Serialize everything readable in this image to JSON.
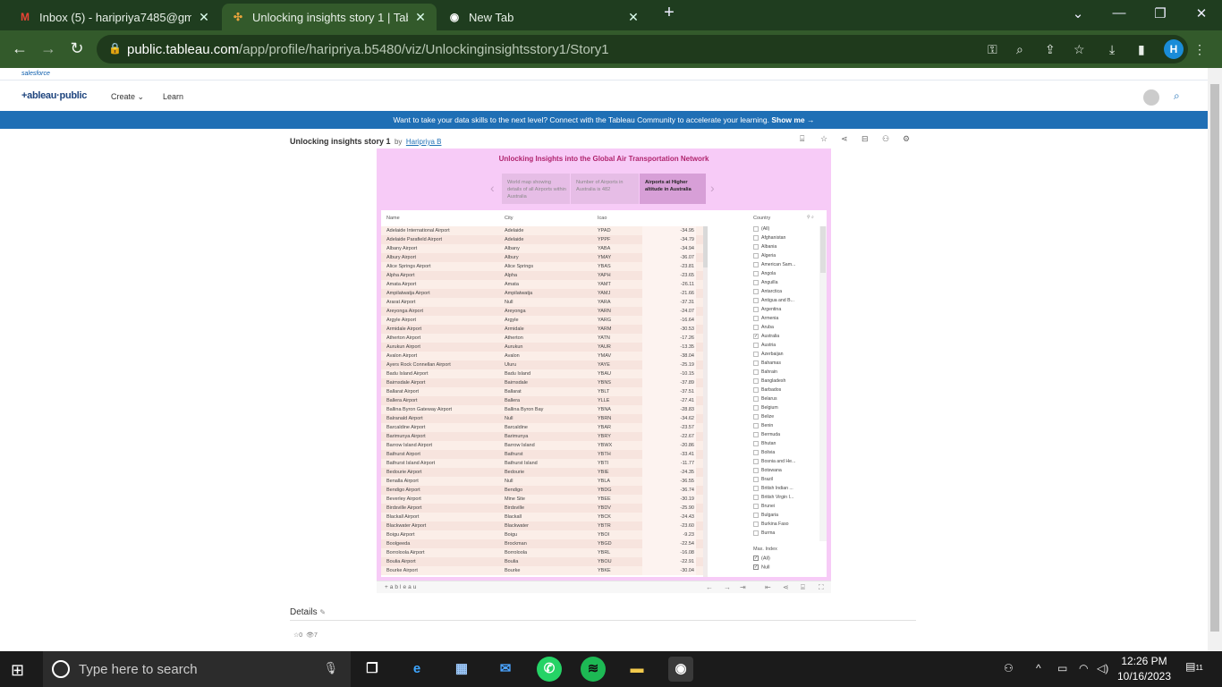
{
  "browser": {
    "tabs": [
      {
        "title": "Inbox (5) - haripriya7485@gmail",
        "icon": "gmail-icon"
      },
      {
        "title": "Unlocking insights story 1 | Table",
        "icon": "tableau-icon"
      },
      {
        "title": "New Tab",
        "icon": "chrome-icon"
      }
    ],
    "url_host": "public.tableau.com",
    "url_path": "/app/profile/haripriya.b5480/viz/Unlockinginsightsstory1/Story1",
    "profile_initial": "H"
  },
  "site": {
    "salesforce_label": "salesforce",
    "logo": "+ableau·public",
    "nav": [
      "Create ⌄",
      "Learn"
    ],
    "banner_text": "Want to take your data skills to the next level? Connect with the Tableau Community to accelerate your learning.",
    "banner_link": "Show me →"
  },
  "viz": {
    "title": "Unlocking insights story 1",
    "by": "by",
    "author": "Haripriya B",
    "story_title": "Unlocking Insights into the Global Air Transportation Network",
    "story_points": [
      "World map showing details of all Airports within Australia",
      "Number of Airports in Australia is 482",
      "Airports at Higher altitude in Australia"
    ],
    "columns": [
      "Name",
      "City",
      "Icao"
    ],
    "rows": [
      [
        "Adelaide International Airport",
        "Adelaide",
        "YPAD",
        "-34.95"
      ],
      [
        "Adelaide Parafield Airport",
        "Adelaide",
        "YPPF",
        "-34.79"
      ],
      [
        "Albany Airport",
        "Albany",
        "YABA",
        "-34.94"
      ],
      [
        "Albury Airport",
        "Albury",
        "YMAY",
        "-36.07"
      ],
      [
        "Alice Springs Airport",
        "Alice Springs",
        "YBAS",
        "-23.81"
      ],
      [
        "Alpha Airport",
        "Alpha",
        "YAPH",
        "-23.65"
      ],
      [
        "Amata Airport",
        "Amata",
        "YAMT",
        "-26.11"
      ],
      [
        "Ampilatwatja Airport",
        "Ampilatwatja",
        "YAMJ",
        "-21.66"
      ],
      [
        "Ararat Airport",
        "Null",
        "YARA",
        "-37.31"
      ],
      [
        "Areyonga Airport",
        "Areyonga",
        "YARN",
        "-24.07"
      ],
      [
        "Argyle Airport",
        "Argyle",
        "YARG",
        "-16.64"
      ],
      [
        "Armidale Airport",
        "Armidale",
        "YARM",
        "-30.53"
      ],
      [
        "Atherton Airport",
        "Atherton",
        "YATN",
        "-17.26"
      ],
      [
        "Aurukun Airport",
        "Aurukun",
        "YAUR",
        "-13.35"
      ],
      [
        "Avalon Airport",
        "Avalon",
        "YMAV",
        "-38.04"
      ],
      [
        "Ayers Rock Connellan Airport",
        "Uluru",
        "YAYE",
        "-25.19"
      ],
      [
        "Badu Island Airport",
        "Badu Island",
        "YBAU",
        "-10.15"
      ],
      [
        "Bairnsdale Airport",
        "Bairnsdale",
        "YBNS",
        "-37.89"
      ],
      [
        "Ballarat Airport",
        "Ballarat",
        "YBLT",
        "-37.51"
      ],
      [
        "Ballera Airport",
        "Ballera",
        "YLLE",
        "-27.41"
      ],
      [
        "Ballina Byron Gateway Airport",
        "Ballina Byron Bay",
        "YBNA",
        "-28.83"
      ],
      [
        "Balranald Airport",
        "Null",
        "YBRN",
        "-34.62"
      ],
      [
        "Barcaldine Airport",
        "Barcaldine",
        "YBAR",
        "-23.57"
      ],
      [
        "Barimunya Airport",
        "Barimunya",
        "YBRY",
        "-22.67"
      ],
      [
        "Barrow Island Airport",
        "Barrow Island",
        "YBWX",
        "-20.86"
      ],
      [
        "Bathurst Airport",
        "Bathurst",
        "YBTH",
        "-33.41"
      ],
      [
        "Bathurst Island Airport",
        "Bathurst Island",
        "YBTI",
        "-11.77"
      ],
      [
        "Bedourie Airport",
        "Bedourie",
        "YBIE",
        "-24.35"
      ],
      [
        "Benalla Airport",
        "Null",
        "YBLA",
        "-36.55"
      ],
      [
        "Bendigo Airport",
        "Bendigo",
        "YBDG",
        "-36.74"
      ],
      [
        "Beverley Airport",
        "Mine Site",
        "YBEE",
        "-30.19"
      ],
      [
        "Birdsville Airport",
        "Birdsville",
        "YBDV",
        "-25.90"
      ],
      [
        "Blackall Airport",
        "Blackall",
        "YBCK",
        "-24.43"
      ],
      [
        "Blackwater Airport",
        "Blackwater",
        "YBTR",
        "-23.60"
      ],
      [
        "Boigu Airport",
        "Boigu",
        "YBOI",
        "-9.23"
      ],
      [
        "Boolgeeda",
        "Brockman",
        "YBGD",
        "-22.54"
      ],
      [
        "Borroloola Airport",
        "Borroloola",
        "YBRL",
        "-16.08"
      ],
      [
        "Boulia Airport",
        "Boulia",
        "YBOU",
        "-22.91"
      ],
      [
        "Bourke Airport",
        "Bourke",
        "YBKE",
        "-30.04"
      ]
    ],
    "filter_title": "Country",
    "countries": [
      "(All)",
      "Afghanistan",
      "Albania",
      "Algeria",
      "American Sam...",
      "Angola",
      "Anguilla",
      "Antarctica",
      "Antigua and B...",
      "Argentina",
      "Armenia",
      "Aruba",
      "Australia",
      "Austria",
      "Azerbaijan",
      "Bahamas",
      "Bahrain",
      "Bangladesh",
      "Barbados",
      "Belarus",
      "Belgium",
      "Belize",
      "Benin",
      "Bermuda",
      "Bhutan",
      "Bolivia",
      "Bosnia and He...",
      "Botswana",
      "Brazil",
      "British Indian ...",
      "British Virgin I...",
      "Brunei",
      "Bulgaria",
      "Burkina Faso",
      "Burma"
    ],
    "checked_country": "Australia",
    "max_index_title": "Max. Index",
    "max_index_options": [
      "(All)",
      "Null"
    ],
    "tableau_mark": "+ableau",
    "details_label": "Details",
    "favorites": "0",
    "views": "7"
  },
  "taskbar": {
    "search_placeholder": "Type here to search",
    "time": "12:26 PM",
    "date": "10/16/2023",
    "notif_count": "11"
  }
}
